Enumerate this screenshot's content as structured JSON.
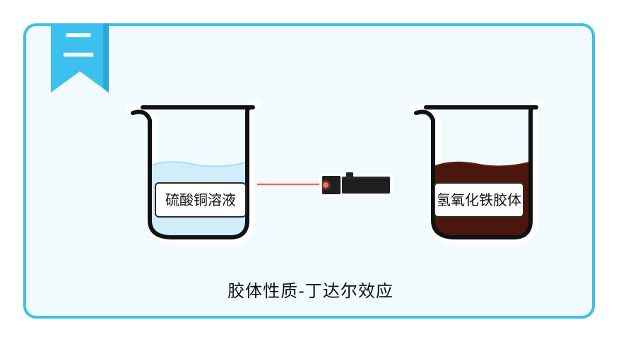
{
  "section": {
    "number_label": "二"
  },
  "left_beaker": {
    "label": "硫酸铜溶液"
  },
  "right_beaker": {
    "label": "氢氧化铁胶体"
  },
  "caption": "胶体性质-丁达尔效应",
  "colors": {
    "frame_border": "#3cc0ee",
    "bookmark": "#3cc0ee",
    "cuso4_solution": "#cfeefa",
    "colloid": "#4a160d",
    "laser_beam": "#e0463a"
  },
  "icons": {
    "bookmark": "ribbon-bookmark-icon",
    "laser_pointer": "laser-pointer-icon"
  }
}
